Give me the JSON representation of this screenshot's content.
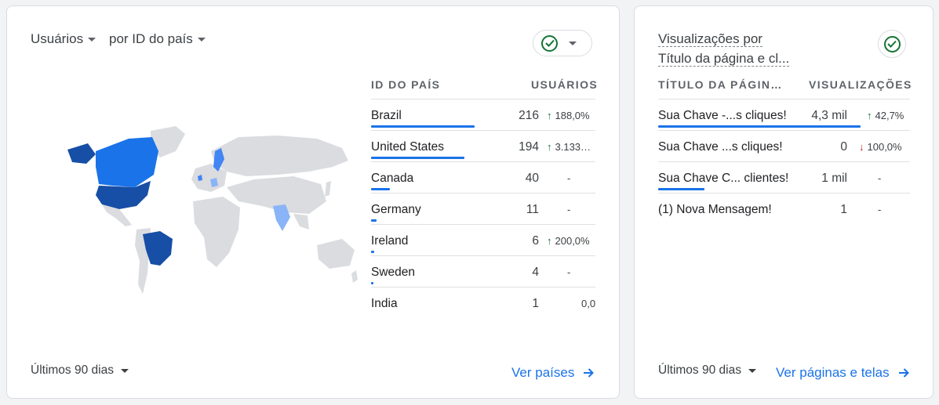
{
  "card1": {
    "metric_label": "Usuários",
    "dimension_label": "por ID do país",
    "col_country": "ID DO PAÍS",
    "col_users": "USUÁRIOS",
    "rows": [
      {
        "name": "Brazil",
        "value": "216",
        "change": "188,0%",
        "trend": "up",
        "bar_fraction": 0.6
      },
      {
        "name": "United States",
        "value": "194",
        "change": "3.133…",
        "trend": "up",
        "bar_fraction": 0.54
      },
      {
        "name": "Canada",
        "value": "40",
        "change": "-",
        "trend": "none",
        "bar_fraction": 0.11
      },
      {
        "name": "Germany",
        "value": "11",
        "change": "-",
        "trend": "none",
        "bar_fraction": 0.03
      },
      {
        "name": "Ireland",
        "value": "6",
        "change": "200,0%",
        "trend": "up",
        "bar_fraction": 0.02
      },
      {
        "name": "Sweden",
        "value": "4",
        "change": "-",
        "trend": "none",
        "bar_fraction": 0.01
      },
      {
        "name": "India",
        "value": "1",
        "change": "0,0",
        "trend": "none",
        "bar_fraction": 0.005
      }
    ],
    "footer_period": "Últimos 90 dias",
    "link_label": "Ver países"
  },
  "card2": {
    "title_line1": "Visualizações por",
    "title_line2": "Título da página e cl...",
    "col_title": "TÍTULO DA PÁGIN…",
    "col_views": "VISUALIZAÇÕES",
    "rows": [
      {
        "name": "Sua Chave -...s cliques!",
        "value": "4,3 mil",
        "change": "42,7%",
        "trend": "up",
        "bar_fraction": 1.0
      },
      {
        "name": "Sua Chave ...s cliques!",
        "value": "0",
        "change": "100,0%",
        "trend": "down",
        "bar_fraction": 0
      },
      {
        "name": "Sua Chave C... clientes!",
        "value": "1 mil",
        "change": "-",
        "trend": "none",
        "bar_fraction": 0.23
      },
      {
        "name": "(1) Nova Mensagem!",
        "value": "1",
        "change": "-",
        "trend": "none",
        "bar_fraction": 0
      }
    ],
    "footer_period": "Últimos 90 dias",
    "link_label": "Ver páginas e telas"
  },
  "colors": {
    "accent": "#1a73e8",
    "map_dark": "#174ea6",
    "map_mid": "#1a73e8",
    "map_light": "#8ab4f8",
    "map_base": "#dadce0",
    "trend_up": "#137333",
    "trend_down": "#c5221f"
  }
}
